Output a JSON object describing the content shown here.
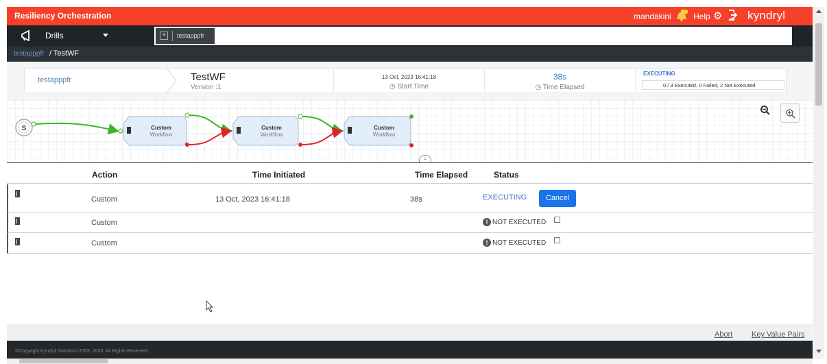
{
  "app": {
    "title": "Resiliency Orchestration",
    "user": "mandakini",
    "help": "Help",
    "brand": "kyndryl"
  },
  "nav": {
    "menu_label": "Drills",
    "open_tab": "testapppfr"
  },
  "breadcrumb": {
    "project": "testapppfr",
    "workflow": "/ TestWF"
  },
  "header": {
    "project": "testapppfr",
    "workflow_name": "TestWF",
    "version": "Version :1",
    "start_time_value": "13 Oct, 2023 16:41:18",
    "start_time_label": "Start Time",
    "elapsed_value": "38s",
    "elapsed_label": "Time Elapsed",
    "status": "EXECUTING",
    "progress_text": "0 / 3 Executed, 0 Failed, 2 Not Executed"
  },
  "workflow": {
    "start_label": "S",
    "nodes": [
      {
        "title": "Custom",
        "subtitle": "Workflow"
      },
      {
        "title": "Custom",
        "subtitle": "Workflow"
      },
      {
        "title": "Custom",
        "subtitle": "Workflow"
      }
    ]
  },
  "table": {
    "headers": {
      "action": "Action",
      "time_initiated": "Time Initiated",
      "time_elapsed": "Time Elapsed",
      "status": "Status"
    },
    "rows": [
      {
        "action": "Custom",
        "time_initiated": "13 Oct, 2023 16:41:18",
        "time_elapsed": "38s",
        "status": "EXECUTING",
        "button": "Cancel"
      },
      {
        "action": "Custom",
        "time_initiated": "",
        "time_elapsed": "",
        "status": "NOT EXECUTED"
      },
      {
        "action": "Custom",
        "time_initiated": "",
        "time_elapsed": "",
        "status": "NOT EXECUTED"
      }
    ]
  },
  "footer": {
    "abort": "Abort",
    "key_value_pairs": "Key Value Pairs",
    "copyright": "©Copyright Kyndryl Solutions 2003, 2023. All Rights Reserved."
  },
  "colors": {
    "topbar": "#f5412a",
    "navbar": "#1f2429",
    "accent": "#1a73e8",
    "link": "#3a79c9",
    "success_edge": "#3cb528",
    "failure_edge": "#d9262a"
  }
}
